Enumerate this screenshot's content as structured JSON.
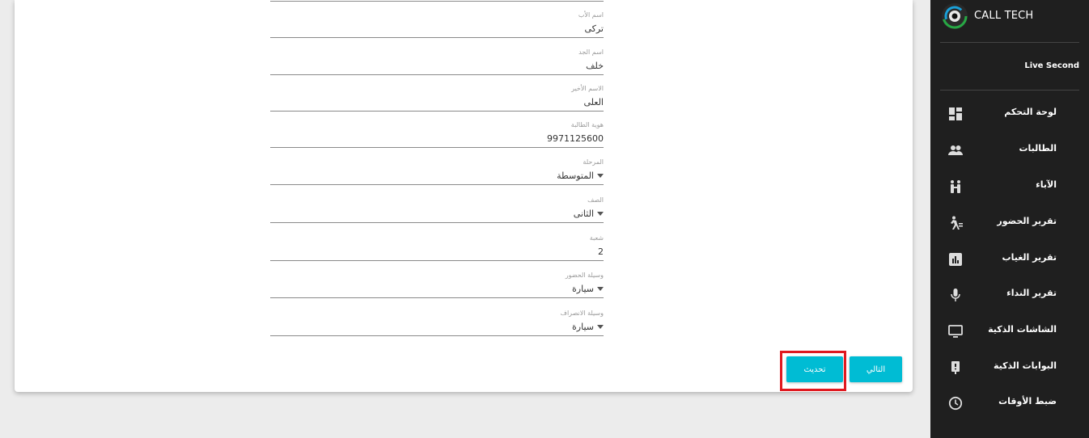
{
  "form": {
    "fields": [
      {
        "label": "اسم الأب",
        "value": "تركى",
        "dropdown": false
      },
      {
        "label": "اسم الجد",
        "value": "خلف",
        "dropdown": false
      },
      {
        "label": "الاسم الأخير",
        "value": "العلى",
        "dropdown": false
      },
      {
        "label": "هوية الطالبة",
        "value": "9971125600",
        "dropdown": false
      },
      {
        "label": "المرحلة",
        "value": "المتوسطة",
        "dropdown": true
      },
      {
        "label": "الصف",
        "value": "الثانى",
        "dropdown": true
      },
      {
        "label": "شعبة",
        "value": "2",
        "dropdown": false
      },
      {
        "label": "وسيلة الحضور",
        "value": "سيارة",
        "dropdown": true
      },
      {
        "label": "وسيلة الانصراف",
        "value": "سيارة",
        "dropdown": true
      }
    ],
    "update_label": "تحديث",
    "next_label": "التالي"
  },
  "sidebar": {
    "brand": "CALL TECH",
    "user": "Live Second",
    "items": [
      {
        "label": "لوحة التحكم",
        "icon": "dashboard-icon"
      },
      {
        "label": "الطالبات",
        "icon": "people-icon"
      },
      {
        "label": "الآباء",
        "icon": "parents-icon"
      },
      {
        "label": "تقرير الحضور",
        "icon": "walking-icon"
      },
      {
        "label": "تقرير الغياب",
        "icon": "bar-chart-icon"
      },
      {
        "label": "تقرير النداء",
        "icon": "microphone-icon"
      },
      {
        "label": "الشاشات الذكية",
        "icon": "monitor-icon"
      },
      {
        "label": "البوابات الذكية",
        "icon": "gate-icon"
      },
      {
        "label": "ضبط الأوقات",
        "icon": "clock-icon"
      }
    ]
  },
  "colors": {
    "accent": "#00bcd4",
    "sidebar": "#1f1f1f",
    "highlight": "#e0191f"
  }
}
